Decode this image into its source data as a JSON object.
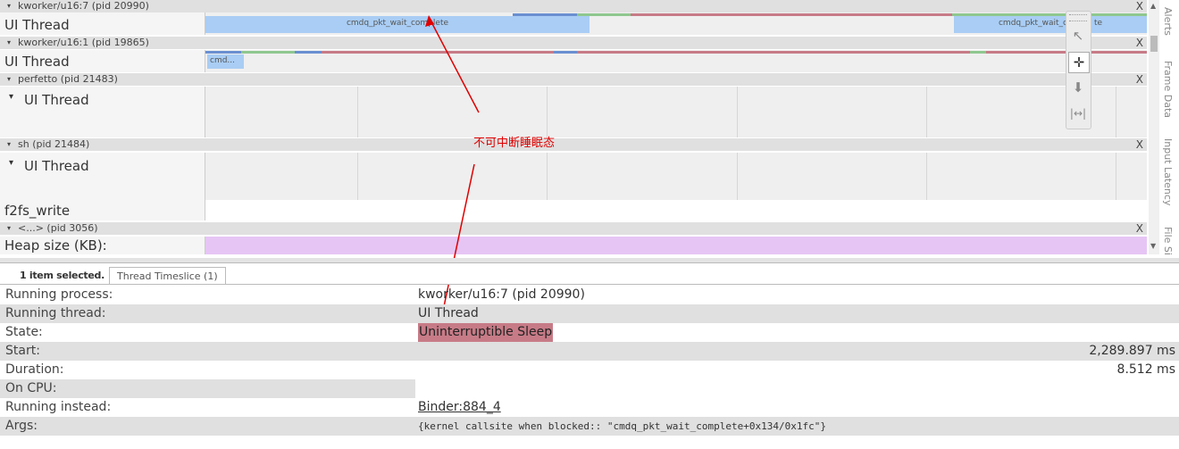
{
  "processes": [
    {
      "title": "kworker/u16:7 (pid 20990)",
      "close": "X"
    },
    {
      "title": "kworker/u16:1 (pid 19865)",
      "close": "X"
    },
    {
      "title": "perfetto (pid 21483)",
      "close": "X"
    },
    {
      "title": "sh (pid 21484)",
      "close": "X"
    },
    {
      "title": "<...> (pid 3056)",
      "close": "X"
    }
  ],
  "tracks": {
    "t1": "UI Thread",
    "t2": "UI Thread",
    "t3": "UI Thread",
    "t4": "UI Thread",
    "t4b": "f2fs_write",
    "t5": "Heap size (KB):"
  },
  "slices": {
    "s1a": "cmdq_pkt_wait_complete",
    "s1b": "cmdq_pkt_wait_c",
    "s1b_tail": "te",
    "s2a": "cmd..."
  },
  "side_tabs": [
    "Alerts",
    "Frame Data",
    "Input Latency",
    "File Si"
  ],
  "annotation": "不可中断睡眠态",
  "details": {
    "tab_selected": "1 item selected.",
    "tab_timeslice": "Thread Timeslice (1)",
    "rows": [
      {
        "label": "Running process:",
        "value": "kworker/u16:7 (pid 20990)"
      },
      {
        "label": "Running thread:",
        "value": "UI Thread"
      },
      {
        "label": "State:",
        "value": "Uninterruptible Sleep"
      },
      {
        "label": "Start:",
        "value": "2,289.897 ms"
      },
      {
        "label": "Duration:",
        "value": "8.512 ms"
      },
      {
        "label": "On CPU:",
        "value": ""
      },
      {
        "label": "Running instead:",
        "value": "Binder:884_4"
      },
      {
        "label": "Args:",
        "value": "{kernel callsite when blocked:: \"cmdq_pkt_wait_complete+0x134/0x1fc\"}"
      }
    ]
  },
  "colors": {
    "slice_blue": "#a9cdf4",
    "sleep_red": "#c77b87",
    "heap_purple": "#e6c5f5",
    "annotation_red": "#e00000"
  }
}
